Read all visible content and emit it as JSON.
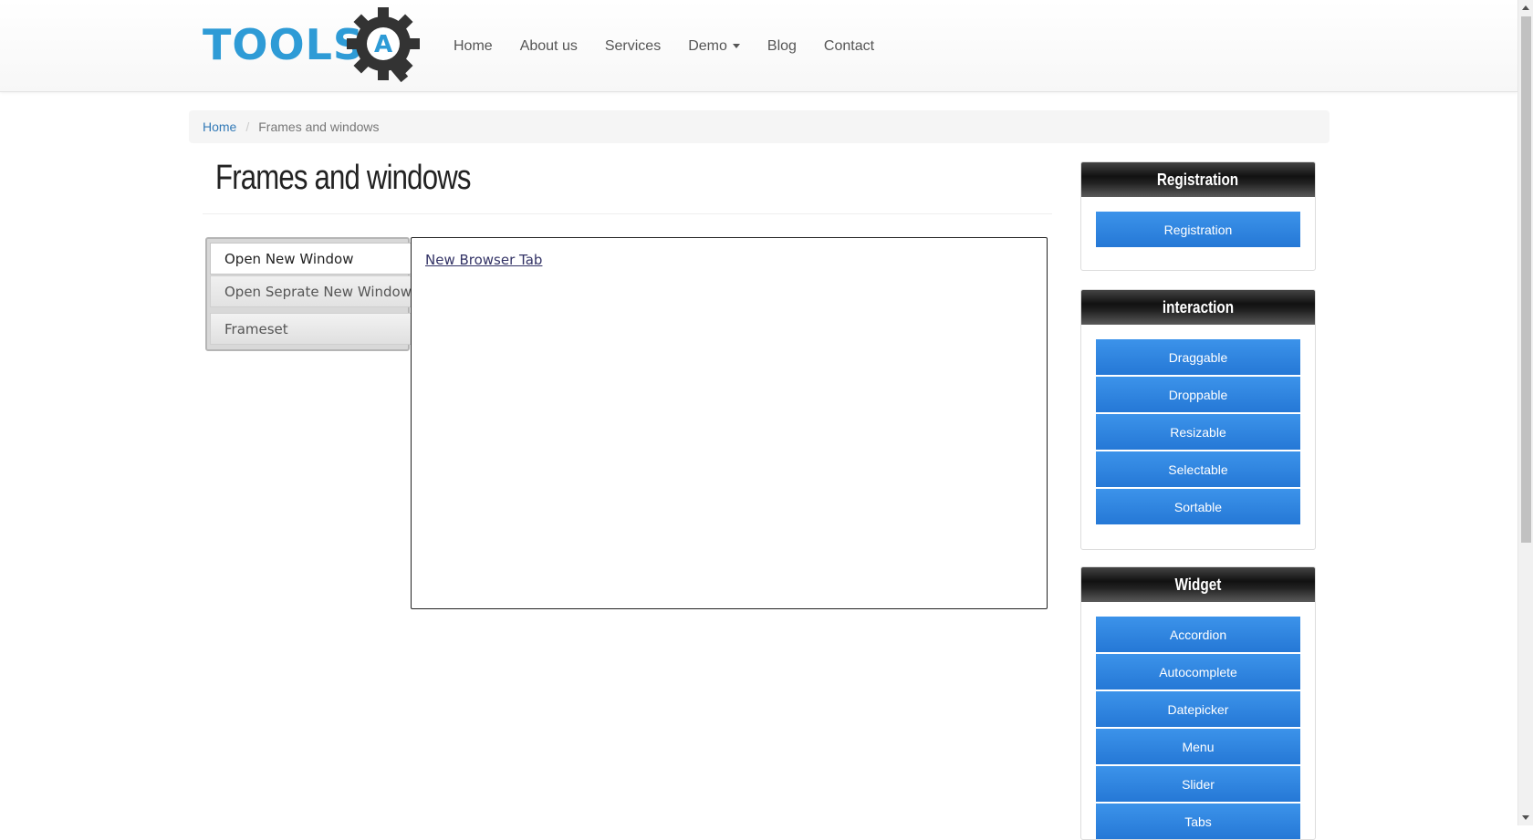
{
  "logo": {
    "text": "TOOLS",
    "gear_letter": "A"
  },
  "nav": {
    "items": [
      "Home",
      "About us",
      "Services",
      "Demo",
      "Blog",
      "Contact"
    ]
  },
  "breadcrumb": {
    "home": "Home",
    "separator": "/",
    "current": "Frames and windows"
  },
  "page": {
    "title": "Frames and windows"
  },
  "tabs": {
    "items": [
      "Open New Window",
      "Open Seprate New Window",
      "Frameset"
    ],
    "active_index": 0,
    "panel_link": "New Browser Tab"
  },
  "sidebar": {
    "registration": {
      "title": "Registration",
      "buttons": [
        "Registration"
      ]
    },
    "interaction": {
      "title": "interaction",
      "buttons": [
        "Draggable",
        "Droppable",
        "Resizable",
        "Selectable",
        "Sortable"
      ]
    },
    "widget": {
      "title": "Widget",
      "buttons": [
        "Accordion",
        "Autocomplete",
        "Datepicker",
        "Menu",
        "Slider",
        "Tabs"
      ]
    }
  },
  "colors": {
    "accent_blue": "#2e86de",
    "logo_blue": "#2e9bd6",
    "link_blue": "#337ab7",
    "widget_header": "#1a1a1a"
  },
  "icons": [
    "gear-logo-icon",
    "caret-down-icon",
    "scroll-up-icon",
    "scroll-down-icon"
  ]
}
